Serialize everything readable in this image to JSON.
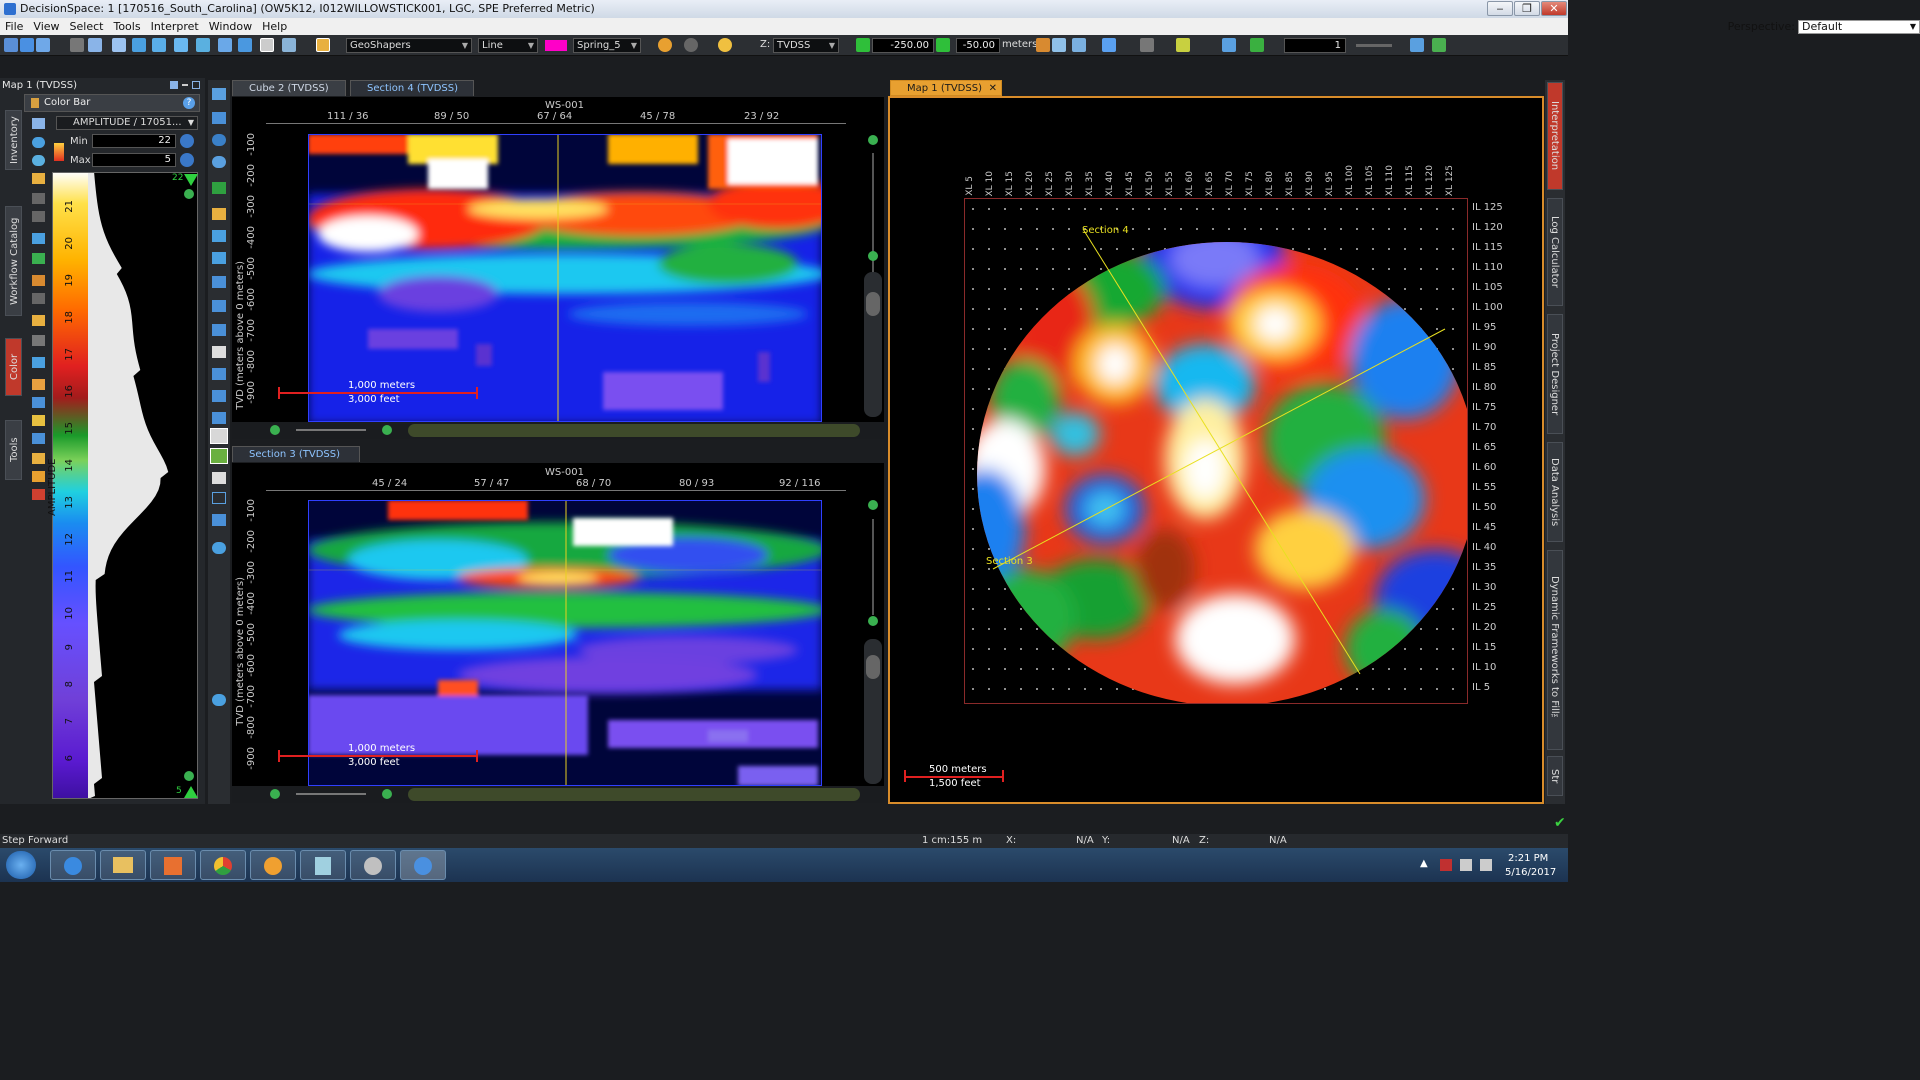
{
  "window": {
    "title": "DecisionSpace: 1 [170516_South_Carolina] (OW5K12, I012WILLOWSTICK001, LGC, SPE Preferred Metric)",
    "minimize_label": "‒",
    "maximize_label": "❐",
    "close_label": "✕"
  },
  "menu": {
    "items": [
      "File",
      "View",
      "Select",
      "Tools",
      "Interpret",
      "Window",
      "Help"
    ]
  },
  "perspective": {
    "label": "Perspective:",
    "value": "Default"
  },
  "toolbar": {
    "tool_select": "GeoShapers",
    "shape_select": "Line",
    "palette_select": "Spring_5",
    "domain_label": "Z:",
    "domain_select": "TVDSS",
    "z_start": "-250.00",
    "z_end": "-50.00",
    "z_unit": "meters",
    "count_value": "1"
  },
  "left_panel": {
    "title": "Map 1 (TVDSS)",
    "vertical_tabs": [
      "Inventory",
      "Workflow Catalog",
      "Color",
      "Tools"
    ],
    "color_bar": {
      "title": "Color Bar",
      "attribute_select": "AMPLITUDE / 17051...",
      "min_label": "Min",
      "min_value": "22",
      "max_label": "Max",
      "max_value": "5",
      "top_marker": "22",
      "bottom_marker": "5",
      "axis_label": "AMPLITUDE",
      "ticks": [
        "21",
        "20",
        "19",
        "18",
        "17",
        "16",
        "15",
        "14",
        "13",
        "12",
        "11",
        "10",
        "9",
        "8",
        "7",
        "6"
      ]
    }
  },
  "views": {
    "top_tabs": [
      "Cube 2 (TVDSS)",
      "Section 4 (TVDSS)"
    ],
    "top_section": {
      "well_label": "WS-001",
      "top_ticks": [
        "111 / 36",
        "89 / 50",
        "67 / 64",
        "45 / 78",
        "23 / 92"
      ],
      "y_axis_label": "TVD (meters above 0 meters)",
      "y_ticks": [
        "-100",
        "-200",
        "-300",
        "-400",
        "-500",
        "-600",
        "-700",
        "-800",
        "-900"
      ],
      "scale_meters": "1,000 meters",
      "scale_feet": "3,000 feet"
    },
    "bottom_tabs": [
      "Section 3 (TVDSS)"
    ],
    "bottom_section": {
      "well_label": "WS-001",
      "top_ticks": [
        "45 / 24",
        "57 / 47",
        "68 / 70",
        "80 / 93",
        "92 / 116"
      ],
      "y_axis_label": "TVD (meters above 0 meters)",
      "y_ticks": [
        "-100",
        "-200",
        "-300",
        "-400",
        "-500",
        "-600",
        "-700",
        "-800",
        "-900"
      ],
      "scale_meters": "1,000 meters",
      "scale_feet": "3,000 feet"
    },
    "map_tab": "Map 1 (TVDSS)",
    "map": {
      "xl_ticks": [
        "XL 5",
        "XL 10",
        "XL 15",
        "XL 20",
        "XL 25",
        "XL 30",
        "XL 35",
        "XL 40",
        "XL 45",
        "XL 50",
        "XL 55",
        "XL 60",
        "XL 65",
        "XL 70",
        "XL 75",
        "XL 80",
        "XL 85",
        "XL 90",
        "XL 95",
        "XL 100",
        "XL 105",
        "XL 110",
        "XL 115",
        "XL 120",
        "XL 125"
      ],
      "il_ticks": [
        "IL 125",
        "IL 120",
        "IL 115",
        "IL 110",
        "IL 105",
        "IL 100",
        "IL 95",
        "IL 90",
        "IL 85",
        "IL 80",
        "IL 75",
        "IL 70",
        "IL 65",
        "IL 60",
        "IL 55",
        "IL 50",
        "IL 45",
        "IL 40",
        "IL 35",
        "IL 30",
        "IL 25",
        "IL 20",
        "IL 15",
        "IL 10",
        "IL 5"
      ],
      "section4_label": "Section 4",
      "section3_label": "Section 3",
      "scale_meters": "500 meters",
      "scale_feet": "1,500 feet"
    }
  },
  "right_vtabs": [
    "Interpretation",
    "Log Calculator",
    "Project Designer",
    "Data Analysis",
    "Dynamic Frameworks to Fill™",
    "Str"
  ],
  "status": {
    "message": "Step Forward",
    "scale": "1 cm:155 m",
    "x_label": "X:",
    "x_value": "N/A",
    "y_label": "Y:",
    "y_value": "N/A",
    "z_label": "Z:",
    "z_value": "N/A"
  },
  "taskbar": {
    "time": "2:21 PM",
    "date": "5/16/2017"
  },
  "colors": {
    "accent": "#d98c2a",
    "close_red": "#c0392b",
    "map_border": "#d98c2a"
  }
}
